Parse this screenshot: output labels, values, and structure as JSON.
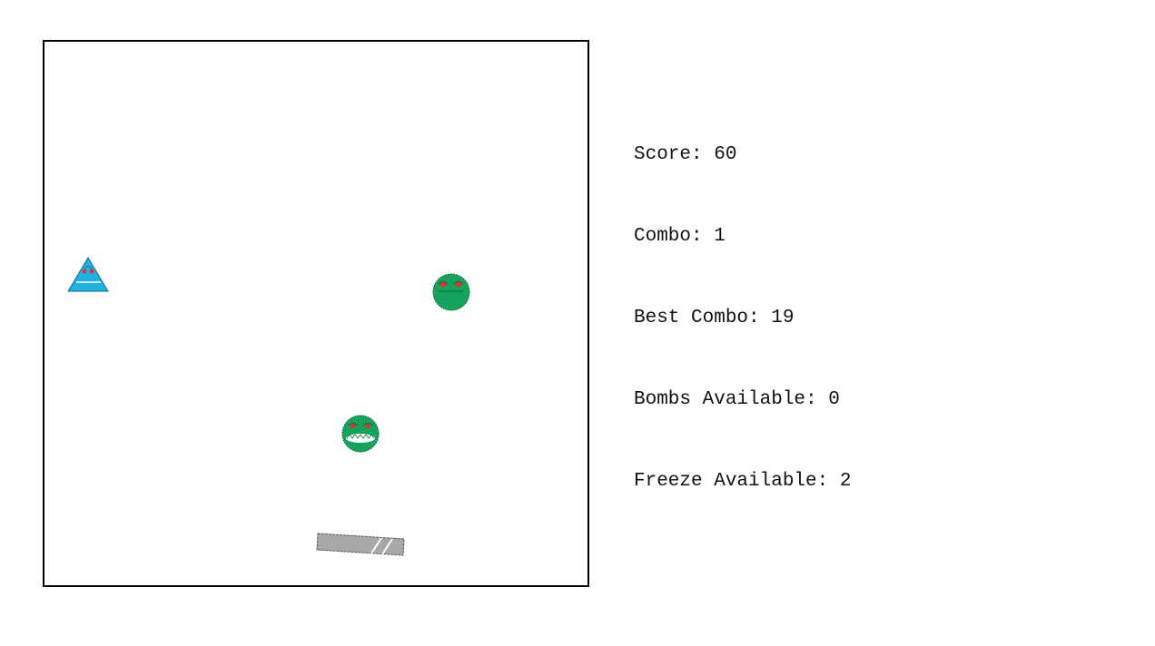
{
  "stats": {
    "score": "Score: 60",
    "combo": "Combo: 1",
    "best_combo": "Best Combo: 19",
    "bombs": "Bombs Available: 0",
    "freeze": "Freeze Available: 2"
  },
  "game": {
    "enemies": [
      {
        "kind": "triangle",
        "icon": "blue-triangle-alien-icon",
        "color": "#1fb2e0"
      },
      {
        "kind": "circle",
        "icon": "green-frog-enemy-icon",
        "color": "#13a35a"
      },
      {
        "kind": "circle-teeth",
        "icon": "green-toothed-enemy-icon",
        "color": "#13a35a"
      }
    ],
    "paddle": {
      "icon": "paddle-icon",
      "color": "#a8a8a8"
    }
  }
}
